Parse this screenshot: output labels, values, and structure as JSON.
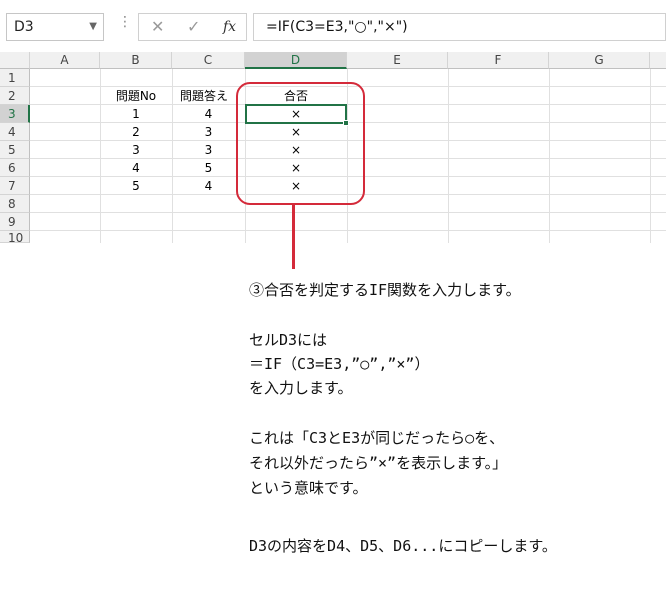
{
  "formula_bar": {
    "name_box": "D3",
    "cancel_icon": "✕",
    "enter_icon": "✓",
    "fx_label": "fx",
    "formula": "=IF(C3=E3,\"○\",\"×\")"
  },
  "columns": [
    "A",
    "B",
    "C",
    "D",
    "E",
    "F",
    "G"
  ],
  "rows": [
    "1",
    "2",
    "3",
    "4",
    "5",
    "6",
    "7",
    "8",
    "9",
    "10"
  ],
  "table": {
    "headers": {
      "b": "問題No",
      "c": "問題答え",
      "d": "合否"
    },
    "rows": [
      {
        "b": "1",
        "c": "4",
        "d": "×"
      },
      {
        "b": "2",
        "c": "3",
        "d": "×"
      },
      {
        "b": "3",
        "c": "3",
        "d": "×"
      },
      {
        "b": "4",
        "c": "5",
        "d": "×"
      },
      {
        "b": "5",
        "c": "4",
        "d": "×"
      }
    ]
  },
  "annotation": {
    "color": "#d42a3a",
    "lines": [
      "③合否を判定するIF関数を入力します。",
      "セルD3には",
      "＝IF（C3=E3,”○”,”×”）",
      "を入力します。",
      "これは「C3とE3が同じだったら○を、",
      "それ以外だったら”×”を表示します。」",
      "という意味です。",
      "D3の内容をD4、D5、D6...にコピーします。"
    ]
  },
  "colors": {
    "accent": "#217346"
  }
}
